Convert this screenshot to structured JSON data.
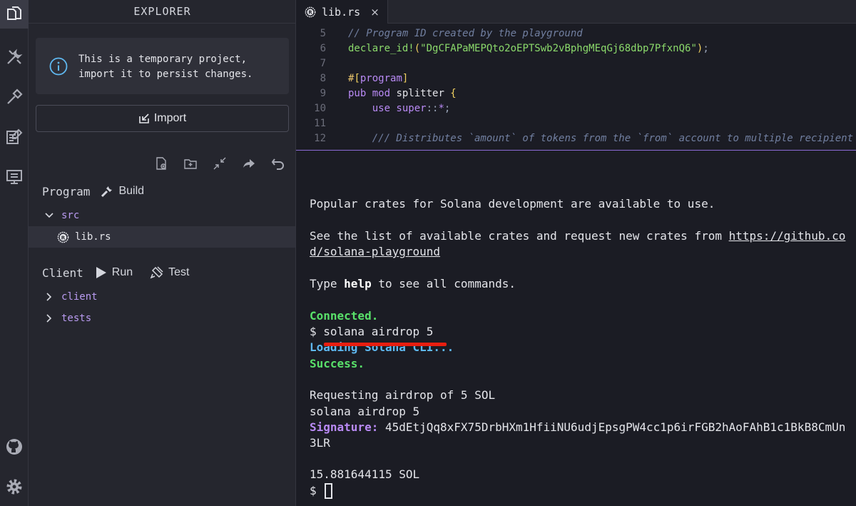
{
  "activity_bar": {
    "top_icons": [
      "files-icon",
      "tools-icon",
      "hammer-icon",
      "tutorials-icon",
      "monitor-icon"
    ],
    "bottom_icons": [
      "github-icon",
      "gear-icon"
    ]
  },
  "explorer": {
    "title": "EXPLORER",
    "notice": "This is a temporary project,\nimport it to persist changes.",
    "import_label": "Import",
    "toolbar_icons": [
      "new-file-icon",
      "new-folder-icon",
      "collapse-icon",
      "share-icon",
      "undo-icon"
    ],
    "program": {
      "title": "Program",
      "build_label": "Build",
      "folder": "src",
      "file": "lib.rs"
    },
    "client": {
      "title": "Client",
      "run_label": "Run",
      "test_label": "Test",
      "folders": [
        "client",
        "tests"
      ]
    }
  },
  "editor": {
    "tab_label": "lib.rs",
    "tab_close": "×",
    "lines": [
      {
        "n": "5",
        "parts": [
          {
            "c": "comment",
            "t": "// Program ID created by the playground"
          }
        ]
      },
      {
        "n": "6",
        "parts": [
          {
            "c": "macro",
            "t": "declare_id!"
          },
          {
            "c": "paren",
            "t": "("
          },
          {
            "c": "string",
            "t": "\"DgCFAPaMEPQto2oEPTSwb2vBphgMEqGj68dbp7PfxnQ6\""
          },
          {
            "c": "paren",
            "t": ")"
          },
          {
            "c": "punct",
            "t": ";"
          }
        ]
      },
      {
        "n": "7",
        "parts": []
      },
      {
        "n": "8",
        "parts": [
          {
            "c": "attr",
            "t": "#"
          },
          {
            "c": "paren",
            "t": "["
          },
          {
            "c": "kw",
            "t": "program"
          },
          {
            "c": "paren",
            "t": "]"
          }
        ]
      },
      {
        "n": "9",
        "parts": [
          {
            "c": "kw",
            "t": "pub mod "
          },
          {
            "c": "ident",
            "t": "splitter "
          },
          {
            "c": "paren",
            "t": "{"
          }
        ]
      },
      {
        "n": "10",
        "parts": [
          {
            "c": "ident",
            "t": "    "
          },
          {
            "c": "kw",
            "t": "use super"
          },
          {
            "c": "punct",
            "t": "::"
          },
          {
            "c": "kw",
            "t": "*"
          },
          {
            "c": "punct",
            "t": ";"
          }
        ]
      },
      {
        "n": "11",
        "parts": []
      },
      {
        "n": "12",
        "parts": [
          {
            "c": "ident",
            "t": "    "
          },
          {
            "c": "comment",
            "t": "/// Distributes `amount` of tokens from the `from` account to multiple recipient"
          }
        ]
      }
    ]
  },
  "terminal": {
    "crates_line": "Popular crates for Solana development are available to use.",
    "list_line_prefix": "See the list of available crates and request new crates from ",
    "list_link_1": "https://github.co",
    "list_link_2": "d/solana-playground",
    "help_prefix": "Type ",
    "help_cmd": "help",
    "help_suffix": " to see all commands.",
    "connected": "Connected.",
    "prompt_cmd": "$ solana airdrop 5",
    "loading": "Loading Solana CLI...",
    "success": "Success.",
    "requesting": "Requesting airdrop of 5 SOL",
    "echo": "solana airdrop 5",
    "signature_label": "Signature:",
    "signature_value": " 45dEtjQq8xFX75DrbHXm1HfiiNU6udjEpsgPW4cc1p6irFGB2hAoFAhB1c1BkB8CmUn",
    "signature_tail": "3LR",
    "balance": "15.881644115 SOL",
    "prompt": "$ "
  },
  "colors": {
    "annotation_underline": "#e81e10",
    "accent_purple": "#b98af5",
    "success_green": "#59e06a"
  }
}
